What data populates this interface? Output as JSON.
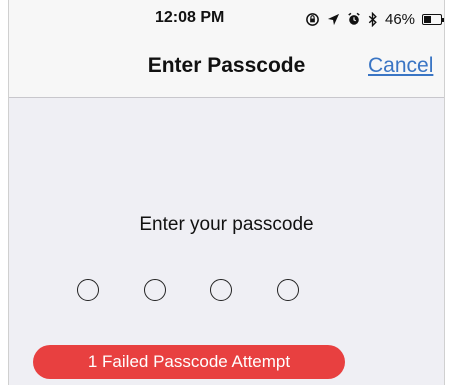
{
  "status_bar": {
    "time": "12:08 PM",
    "icons": [
      "screen-rotation-lock-icon",
      "location-arrow-icon",
      "alarm-icon",
      "bluetooth-icon"
    ],
    "battery_percent": "46%",
    "battery_level": 0.46
  },
  "nav": {
    "title": "Enter Passcode",
    "cancel_label": "Cancel"
  },
  "passcode": {
    "prompt": "Enter your passcode",
    "digit_count": 4,
    "entered": 0
  },
  "alert": {
    "failed_attempts_text": "1 Failed Passcode Attempt",
    "color": "#e84040"
  },
  "colors": {
    "link": "#3a75c4",
    "background": "#efeff4",
    "navbar": "#f7f7f7"
  }
}
